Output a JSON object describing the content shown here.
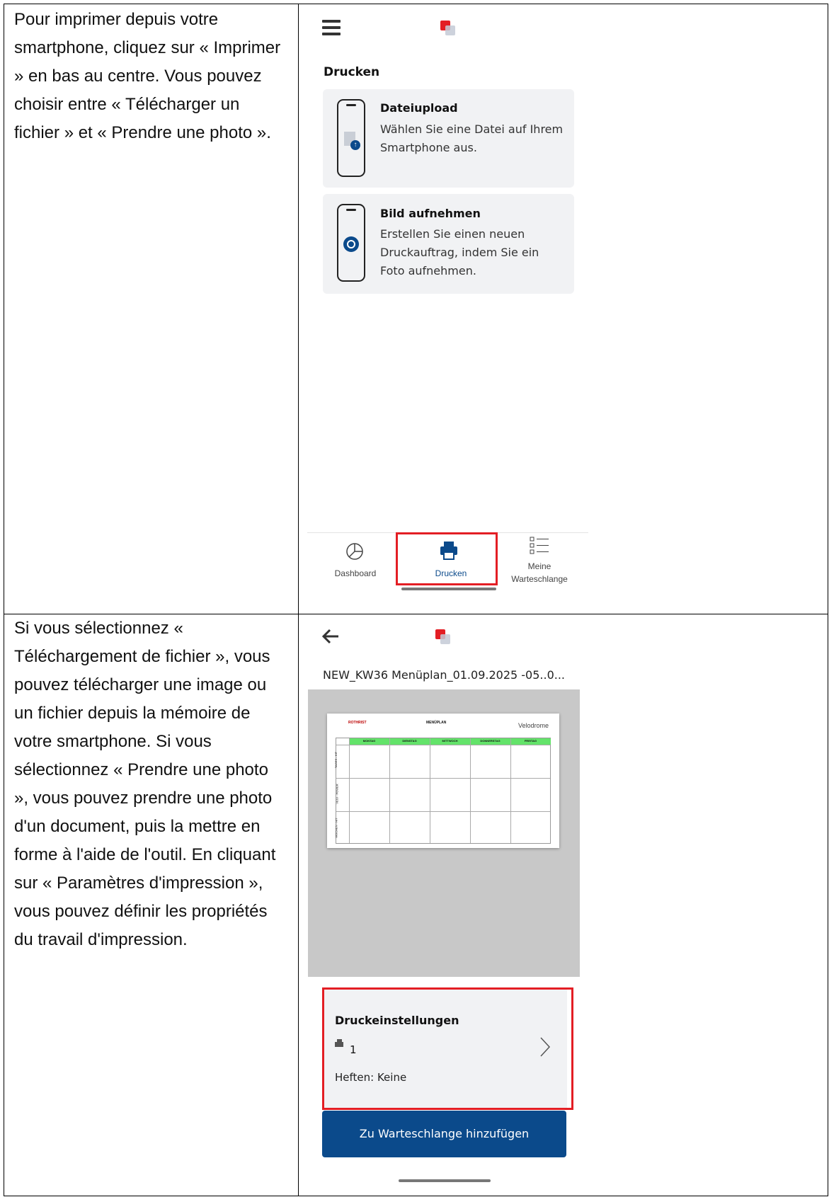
{
  "instructions": {
    "row1": "Pour imprimer depuis votre smartphone, cliquez sur « Imprimer » en bas au centre. Vous pouvez choisir entre « Télécharger un fichier » et « Prendre une photo ».",
    "row2": "Si vous sélectionnez « Téléchargement de fichier », vous pouvez télécharger une image ou un fichier depuis la mémoire de votre smartphone. Si vous sélectionnez « Prendre une photo », vous pouvez prendre une photo d'un document, puis la mettre en forme à l'aide de l'outil. En cliquant sur « Paramètres d'impression », vous pouvez définir les propriétés du travail d'impression."
  },
  "screen1": {
    "title": "Drucken",
    "options": [
      {
        "title": "Dateiupload",
        "desc": "Wählen Sie eine Datei auf Ihrem Smartphone aus.",
        "icon": "file-upload-icon"
      },
      {
        "title": "Bild aufnehmen",
        "desc": "Erstellen Sie einen neuen Druckauftrag, indem Sie ein Foto aufnehmen.",
        "icon": "camera-shutter-icon"
      }
    ],
    "nav": {
      "dashboard": "Dashboard",
      "drucken": "Drucken",
      "queue_line1": "Meine",
      "queue_line2": "Warteschlange"
    },
    "colors": {
      "accent": "#0b4a8b",
      "highlight": "#e31e24",
      "card": "#f1f2f4"
    }
  },
  "screen2": {
    "filename": "NEW_KW36 Menüplan_01.09.2025 -05..0...",
    "document": {
      "brand_left": "ROTHRIST",
      "title": "MENÜPLAN",
      "brand_right": "Velodrome",
      "days": [
        "MONTAG",
        "DIENSTAG",
        "MITTWOCH",
        "DONNERSTAG",
        "FREITAG"
      ],
      "row_labels": [
        "TAGES - HIT",
        "VEGI - POWER",
        "WOCHEN - HIT"
      ]
    },
    "settings": {
      "title": "Druckeinstellungen",
      "copies": "1",
      "stapling": "Heften: Keine"
    },
    "add_button": "Zu Warteschlange hinzufügen"
  }
}
